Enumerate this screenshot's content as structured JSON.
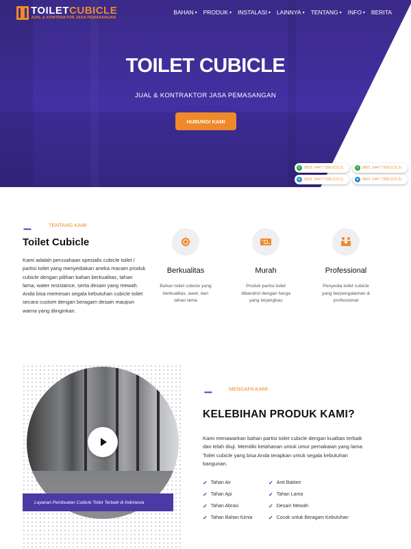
{
  "header": {
    "logo_main_white": "TOILET",
    "logo_main_orange": "CUBICLE",
    "logo_sub": "JUAL & KONTRAKTOR JASA PEMASANGAN",
    "nav": [
      {
        "label": "BAHAN",
        "dropdown": true
      },
      {
        "label": "PRODUK",
        "dropdown": true
      },
      {
        "label": "INSTALASI",
        "dropdown": true
      },
      {
        "label": "LAINNYA",
        "dropdown": true
      },
      {
        "label": "TENTANG",
        "dropdown": true
      },
      {
        "label": "INFO",
        "dropdown": true
      },
      {
        "label": "BERITA",
        "dropdown": false
      }
    ]
  },
  "hero": {
    "title": "TOILET CUBICLE",
    "subtitle": "JUAL & KONTRAKTOR JASA PEMASANGAN",
    "cta": "HUBUNGI KAMI",
    "contacts": [
      {
        "icon": "whatsapp-icon",
        "label": "0821 1447 7155 (CS 1)"
      },
      {
        "icon": "whatsapp-icon",
        "label": "0821 1447 7255 (CS 2)"
      },
      {
        "icon": "telegram-icon",
        "label": "0821 1447 7155 (CS 1)"
      },
      {
        "icon": "telegram-icon",
        "label": "0821 1447 7255 (CS 2)"
      }
    ]
  },
  "about": {
    "eyebrow": "TENTANG KAMI",
    "title": "Toilet Cubicle",
    "description": "Kami adalah perusahaan spesialis cubicle toilet / partisi toilet yang menyediakan aneka macam produk cubicle dengan pilihan bahan berkualitas, tahan lama, water resistance, serta desain yang mewah. Anda bisa memesan segala kebutuhan cubicle toilet secara custom dengan beragam desain maupun warna yang diinginkan.",
    "features": [
      {
        "icon": "badge-icon",
        "name": "Berkualitas",
        "desc": "Bahan toilet cubicle yang berkualitas, awet, dan tahan lama"
      },
      {
        "icon": "money-icon",
        "name": "Murah",
        "desc": "Produk partisi toilet dibandrol dengan harga yang terjangkau"
      },
      {
        "icon": "handshake-icon",
        "name": "Professional",
        "desc": "Penyedia toilet cubicle yang berpengalaman & professional"
      }
    ]
  },
  "why": {
    "eyebrow": "MENGAPA KAMI",
    "title": "KELEBIHAN PRODUK KAMI?",
    "description": "Kami menawarkan bahan partisi toilet cubicle dengan kualitas terbaik dan telah diuji. Memiliki ketahanan untuk umur pemakaian yang lama. Toilet cubicle yang bisa Anda terapkan untuk segala kebutuhan bangunan.",
    "video_caption": "Layanan Pembuatan Cubicle Toilet Terbaik di Indonesia",
    "benefits": [
      "Tahan Air",
      "Anti Bakteri",
      "Tahan Api",
      "Tahan Lama",
      "Tahan Abrasi",
      "Desain Mewah",
      "Tahan Bahan Kimia",
      "Cocok untuk Beragam Kebutuhan"
    ]
  },
  "colors": {
    "brand_purple": "#4330a3",
    "accent_orange": "#f0892a"
  }
}
